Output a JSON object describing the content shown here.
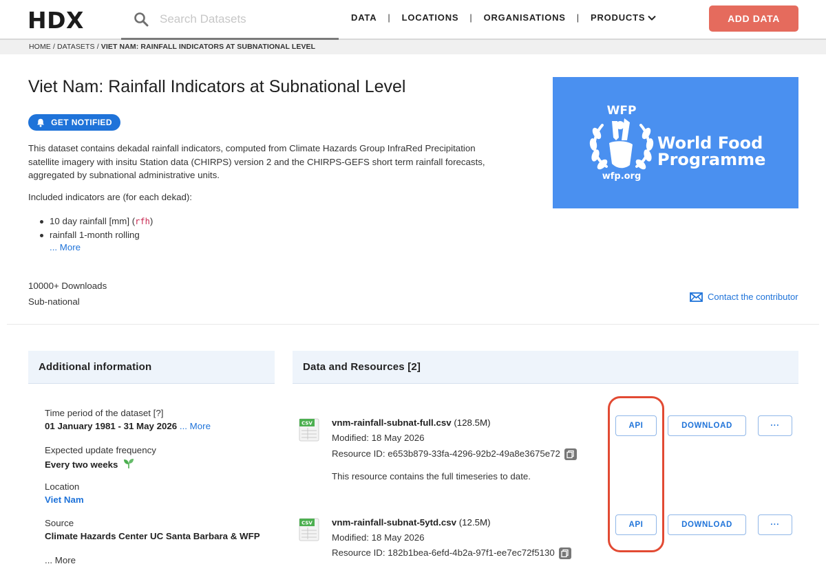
{
  "header": {
    "logo": "HDX",
    "search_placeholder": "Search Datasets",
    "nav": [
      "DATA",
      "LOCATIONS",
      "ORGANISATIONS",
      "PRODUCTS"
    ],
    "add_data_label": "ADD DATA"
  },
  "breadcrumb": {
    "home": "HOME",
    "datasets": "DATASETS",
    "current": "VIET NAM: RAINFALL INDICATORS AT SUBNATIONAL LEVEL"
  },
  "dataset": {
    "title": "Viet Nam: Rainfall Indicators at Subnational Level",
    "notify_label": "GET NOTIFIED",
    "description_lines": [
      "This dataset contains dekadal rainfall indicators, computed from Climate Hazards Group InfraRed Precipitation",
      "satellite imagery with insitu Station data (CHIRPS) version 2 and the CHIRPS-GEFS short term rainfall forecasts,",
      "aggregated by subnational administrative units."
    ],
    "indicators_intro": "Included indicators are (for each dekad):",
    "indicators": [
      {
        "text": "10 day rainfall [mm] (",
        "code": "rfh",
        "tail": ")"
      },
      {
        "text": "rainfall 1-month rolling",
        "code": "",
        "tail": ""
      }
    ],
    "indicators_more": "... More",
    "downloads": "10000+ Downloads",
    "granularity": "Sub-national",
    "contact_label": "Contact the contributor"
  },
  "org_logo": {
    "acronym": "WFP",
    "name_line1": "World Food",
    "name_line2": "Programme",
    "url": "wfp.org",
    "bg_color": "#4a90f0"
  },
  "additional_info": {
    "heading": "Additional information",
    "time_period_label": "Time period of the dataset [?]",
    "time_period_value": "01 January 1981 - 31 May 2026",
    "time_period_more": "... More",
    "update_freq_label": "Expected update frequency",
    "update_freq_value": "Every two weeks",
    "location_label": "Location",
    "location_value": "Viet Nam",
    "source_label": "Source",
    "source_value": "Climate Hazards Center UC Santa Barbara & WFP",
    "source_more": "... More"
  },
  "resources": {
    "heading": "Data and Resources [2]",
    "icon_label": "CSV",
    "api_label": "API",
    "download_label": "DOWNLOAD",
    "more_label": "···",
    "items": [
      {
        "name": "vnm-rainfall-subnat-full.csv",
        "size": "(128.5M)",
        "modified": "Modified: 18 May 2026",
        "resource_id": "Resource ID: e653b879-33fa-4296-92b2-49a8e3675e72",
        "description": "This resource contains the full timeseries to date."
      },
      {
        "name": "vnm-rainfall-subnat-5ytd.csv",
        "size": "(12.5M)",
        "modified": "Modified: 18 May 2026",
        "resource_id": "Resource ID: 182b1bea-6efd-4b2a-97f1-ee7ec72f5130",
        "description": ""
      }
    ]
  },
  "colors": {
    "accent_blue": "#1f73d9",
    "add_data_red": "#e56b5d",
    "highlight_red": "#e24a33"
  }
}
